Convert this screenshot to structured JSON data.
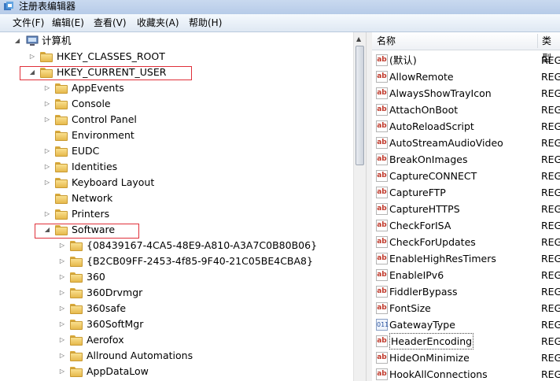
{
  "window": {
    "title": "注册表编辑器"
  },
  "menu": [
    "文件(F)",
    "编辑(E)",
    "查看(V)",
    "收藏夹(A)",
    "帮助(H)"
  ],
  "tree": {
    "root": "计算机",
    "items": [
      "HKEY_CLASSES_ROOT",
      "HKEY_CURRENT_USER",
      "AppEvents",
      "Console",
      "Control Panel",
      "Environment",
      "EUDC",
      "Identities",
      "Keyboard Layout",
      "Network",
      "Printers",
      "Software",
      "{08439167-4CA5-48E9-A810-A3A7C0B80B06}",
      "{B2CB09FF-2453-4f85-9F40-21C05BE4CBA8}",
      "360",
      "360Drvmgr",
      "360safe",
      "360SoftMgr",
      "Aerofox",
      "Allround Automations",
      "AppDataLow"
    ]
  },
  "values_pane": {
    "header_name": "名称",
    "header_type": "类型",
    "rows": [
      {
        "name": "(默认)",
        "type": "REG",
        "icon": "string-value-icon"
      },
      {
        "name": "AllowRemote",
        "type": "REG",
        "icon": "string-value-icon"
      },
      {
        "name": "AlwaysShowTrayIcon",
        "type": "REG",
        "icon": "string-value-icon"
      },
      {
        "name": "AttachOnBoot",
        "type": "REG",
        "icon": "string-value-icon"
      },
      {
        "name": "AutoReloadScript",
        "type": "REG",
        "icon": "string-value-icon"
      },
      {
        "name": "AutoStreamAudioVideo",
        "type": "REG",
        "icon": "string-value-icon"
      },
      {
        "name": "BreakOnImages",
        "type": "REG",
        "icon": "string-value-icon"
      },
      {
        "name": "CaptureCONNECT",
        "type": "REG",
        "icon": "string-value-icon"
      },
      {
        "name": "CaptureFTP",
        "type": "REG",
        "icon": "string-value-icon"
      },
      {
        "name": "CaptureHTTPS",
        "type": "REG",
        "icon": "string-value-icon"
      },
      {
        "name": "CheckForISA",
        "type": "REG",
        "icon": "string-value-icon"
      },
      {
        "name": "CheckForUpdates",
        "type": "REG",
        "icon": "string-value-icon"
      },
      {
        "name": "EnableHighResTimers",
        "type": "REG",
        "icon": "string-value-icon"
      },
      {
        "name": "EnableIPv6",
        "type": "REG",
        "icon": "string-value-icon"
      },
      {
        "name": "FiddlerBypass",
        "type": "REG",
        "icon": "string-value-icon"
      },
      {
        "name": "FontSize",
        "type": "REG",
        "icon": "string-value-icon"
      },
      {
        "name": "GatewayType",
        "type": "REG",
        "icon": "binary-value-icon"
      },
      {
        "name": "HeaderEncoding",
        "type": "REG",
        "icon": "string-value-icon"
      },
      {
        "name": "HideOnMinimize",
        "type": "REG",
        "icon": "string-value-icon"
      },
      {
        "name": "HookAllConnections",
        "type": "REG",
        "icon": "string-value-icon"
      }
    ]
  },
  "icons": {
    "string_value": "ab",
    "binary_value": "011"
  },
  "colors": {
    "highlight_box": "#e0303a",
    "folder": "#f3d17a",
    "title_bar": "#c9d9ef"
  }
}
